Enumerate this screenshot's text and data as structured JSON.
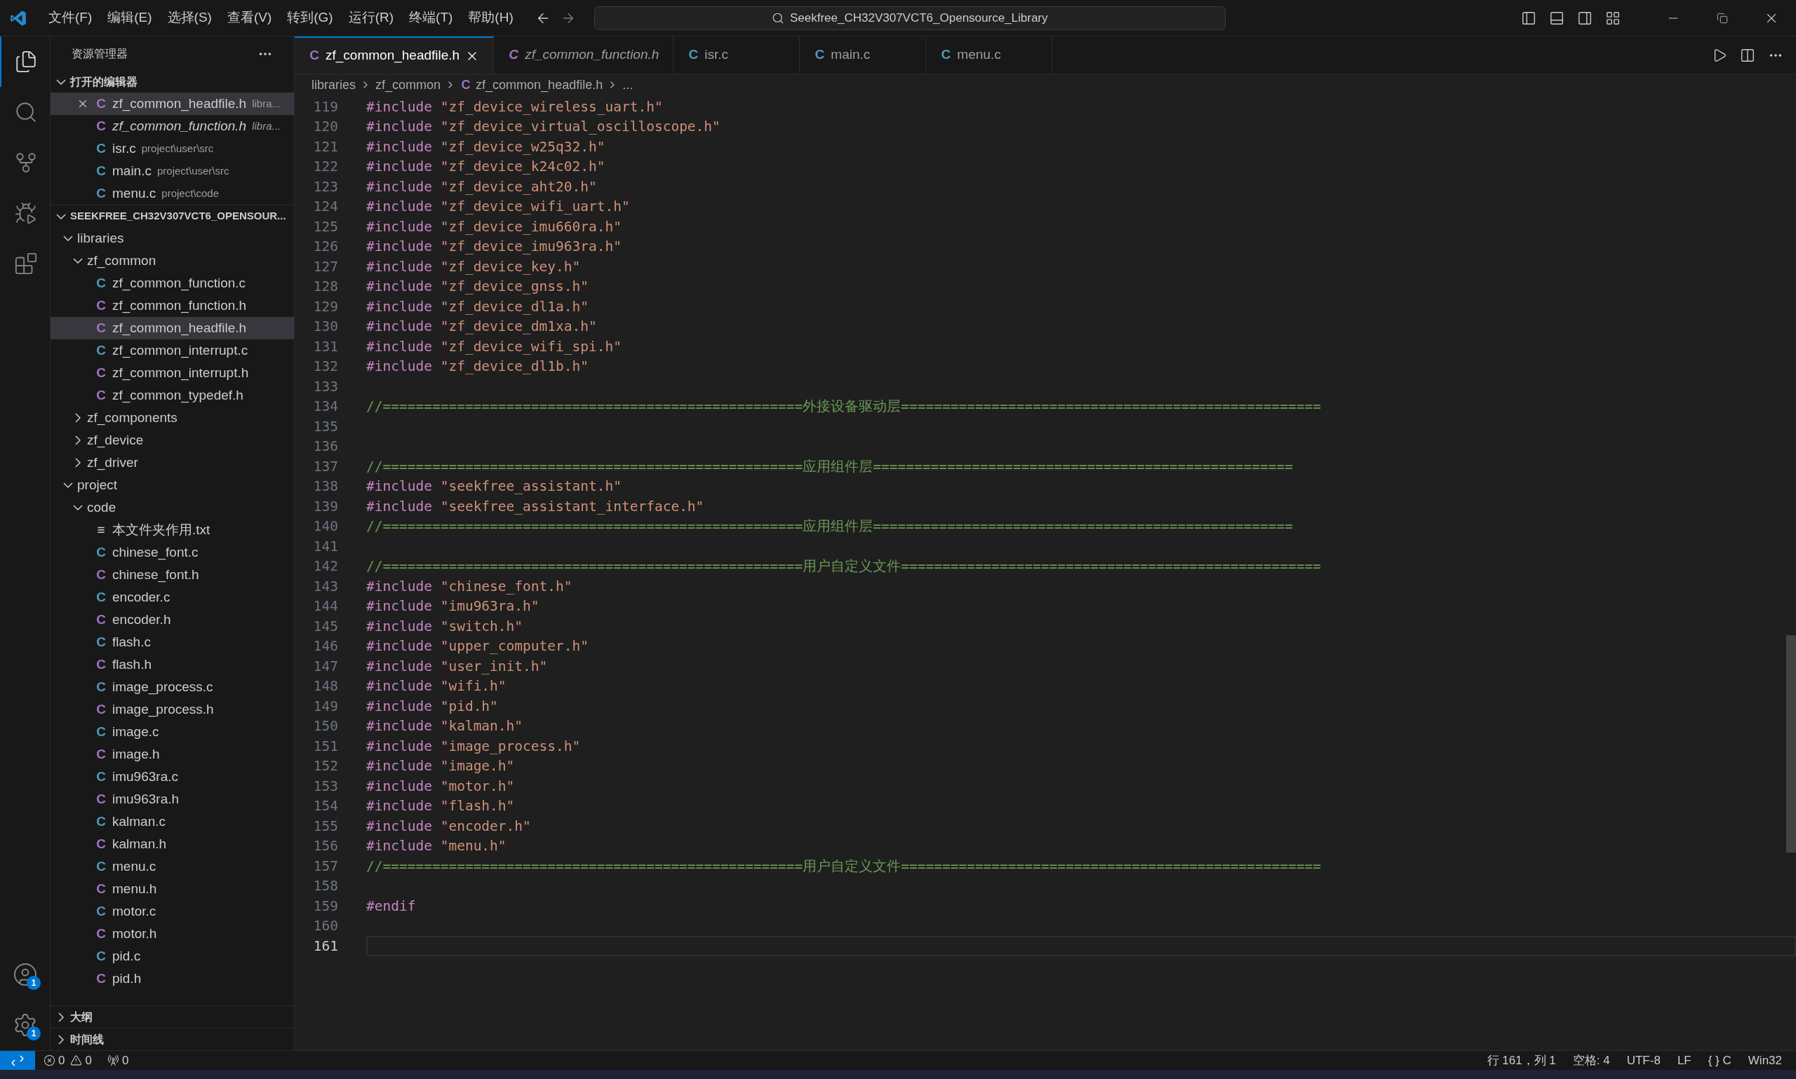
{
  "menu": [
    "文件(F)",
    "编辑(E)",
    "选择(S)",
    "查看(V)",
    "转到(G)",
    "运行(R)",
    "终端(T)",
    "帮助(H)"
  ],
  "search": {
    "value": "Seekfree_CH32V307VCT6_Opensource_Library"
  },
  "activity_bar": {
    "items": [
      {
        "kind": "explorer",
        "selected": true
      },
      {
        "kind": "search",
        "selected": false
      },
      {
        "kind": "source_control",
        "selected": false
      },
      {
        "kind": "debug",
        "selected": false
      },
      {
        "kind": "extensions",
        "selected": false
      }
    ],
    "bottom": [
      {
        "kind": "accounts",
        "badge": "1"
      },
      {
        "kind": "settings",
        "badge": "1"
      }
    ]
  },
  "sidebar": {
    "title": "资源管理器",
    "open_editors": {
      "label": "打开的编辑器",
      "expanded": true,
      "items": [
        {
          "icon": "C",
          "color": "#a074c4",
          "name": "zf_common_headfile.h",
          "path": "libra...",
          "preview": false,
          "selected": true
        },
        {
          "icon": "C",
          "color": "#a074c4",
          "name": "zf_common_function.h",
          "path": "libra...",
          "preview": true,
          "selected": false
        },
        {
          "icon": "C",
          "color": "#519aba",
          "name": "isr.c",
          "path": "project\\user\\src",
          "preview": false,
          "selected": false
        },
        {
          "icon": "C",
          "color": "#519aba",
          "name": "main.c",
          "path": "project\\user\\src",
          "preview": false,
          "selected": false
        },
        {
          "icon": "C",
          "color": "#519aba",
          "name": "menu.c",
          "path": "project\\code",
          "preview": false,
          "selected": false
        }
      ]
    },
    "workspace": {
      "label": "SEEKFREE_CH32V307VCT6_OPENSOUR...",
      "expanded": true,
      "children": [
        {
          "kind": "folder",
          "name": "libraries",
          "expanded": true,
          "selected": false,
          "children": [
            {
              "kind": "folder",
              "name": "zf_common",
              "expanded": true,
              "selected": false,
              "children": [
                {
                  "kind": "file",
                  "icon": "C",
                  "color": "#519aba",
                  "name": "zf_common_function.c",
                  "selected": false
                },
                {
                  "kind": "file",
                  "icon": "C",
                  "color": "#a074c4",
                  "name": "zf_common_function.h",
                  "selected": false
                },
                {
                  "kind": "file",
                  "icon": "C",
                  "color": "#a074c4",
                  "name": "zf_common_headfile.h",
                  "selected": true
                },
                {
                  "kind": "file",
                  "icon": "C",
                  "color": "#519aba",
                  "name": "zf_common_interrupt.c",
                  "selected": false
                },
                {
                  "kind": "file",
                  "icon": "C",
                  "color": "#a074c4",
                  "name": "zf_common_interrupt.h",
                  "selected": false
                },
                {
                  "kind": "file",
                  "icon": "C",
                  "color": "#a074c4",
                  "name": "zf_common_typedef.h",
                  "selected": false
                }
              ]
            },
            {
              "kind": "folder",
              "name": "zf_components",
              "expanded": false,
              "selected": false
            },
            {
              "kind": "folder",
              "name": "zf_device",
              "expanded": false,
              "selected": false
            },
            {
              "kind": "folder",
              "name": "zf_driver",
              "expanded": false,
              "selected": false
            }
          ]
        },
        {
          "kind": "folder",
          "name": "project",
          "expanded": true,
          "selected": false,
          "children": [
            {
              "kind": "folder",
              "name": "code",
              "expanded": true,
              "selected": false,
              "children": [
                {
                  "kind": "file",
                  "icon": "≡",
                  "color": "#cccccc",
                  "name": "本文件夹作用.txt",
                  "selected": false
                },
                {
                  "kind": "file",
                  "icon": "C",
                  "color": "#519aba",
                  "name": "chinese_font.c",
                  "selected": false
                },
                {
                  "kind": "file",
                  "icon": "C",
                  "color": "#a074c4",
                  "name": "chinese_font.h",
                  "selected": false
                },
                {
                  "kind": "file",
                  "icon": "C",
                  "color": "#519aba",
                  "name": "encoder.c",
                  "selected": false
                },
                {
                  "kind": "file",
                  "icon": "C",
                  "color": "#a074c4",
                  "name": "encoder.h",
                  "selected": false
                },
                {
                  "kind": "file",
                  "icon": "C",
                  "color": "#519aba",
                  "name": "flash.c",
                  "selected": false
                },
                {
                  "kind": "file",
                  "icon": "C",
                  "color": "#a074c4",
                  "name": "flash.h",
                  "selected": false
                },
                {
                  "kind": "file",
                  "icon": "C",
                  "color": "#519aba",
                  "name": "image_process.c",
                  "selected": false
                },
                {
                  "kind": "file",
                  "icon": "C",
                  "color": "#a074c4",
                  "name": "image_process.h",
                  "selected": false
                },
                {
                  "kind": "file",
                  "icon": "C",
                  "color": "#519aba",
                  "name": "image.c",
                  "selected": false
                },
                {
                  "kind": "file",
                  "icon": "C",
                  "color": "#a074c4",
                  "name": "image.h",
                  "selected": false
                },
                {
                  "kind": "file",
                  "icon": "C",
                  "color": "#519aba",
                  "name": "imu963ra.c",
                  "selected": false
                },
                {
                  "kind": "file",
                  "icon": "C",
                  "color": "#a074c4",
                  "name": "imu963ra.h",
                  "selected": false
                },
                {
                  "kind": "file",
                  "icon": "C",
                  "color": "#519aba",
                  "name": "kalman.c",
                  "selected": false
                },
                {
                  "kind": "file",
                  "icon": "C",
                  "color": "#a074c4",
                  "name": "kalman.h",
                  "selected": false
                },
                {
                  "kind": "file",
                  "icon": "C",
                  "color": "#519aba",
                  "name": "menu.c",
                  "selected": false
                },
                {
                  "kind": "file",
                  "icon": "C",
                  "color": "#a074c4",
                  "name": "menu.h",
                  "selected": false
                },
                {
                  "kind": "file",
                  "icon": "C",
                  "color": "#519aba",
                  "name": "motor.c",
                  "selected": false
                },
                {
                  "kind": "file",
                  "icon": "C",
                  "color": "#a074c4",
                  "name": "motor.h",
                  "selected": false
                },
                {
                  "kind": "file",
                  "icon": "C",
                  "color": "#519aba",
                  "name": "pid.c",
                  "selected": false
                },
                {
                  "kind": "file",
                  "icon": "C",
                  "color": "#a074c4",
                  "name": "pid.h",
                  "selected": false
                }
              ]
            }
          ]
        }
      ]
    },
    "panels": [
      {
        "label": "大纲",
        "expanded": false
      },
      {
        "label": "时间线",
        "expanded": false
      }
    ]
  },
  "tabs": [
    {
      "icon": "C",
      "color": "#a074c4",
      "label": "zf_common_headfile.h",
      "selected": true,
      "preview": false
    },
    {
      "icon": "C",
      "color": "#a074c4",
      "label": "zf_common_function.h",
      "selected": false,
      "preview": true
    },
    {
      "icon": "C",
      "color": "#519aba",
      "label": "isr.c",
      "selected": false,
      "preview": false
    },
    {
      "icon": "C",
      "color": "#519aba",
      "label": "main.c",
      "selected": false,
      "preview": false
    },
    {
      "icon": "C",
      "color": "#519aba",
      "label": "menu.c",
      "selected": false,
      "preview": false
    }
  ],
  "breadcrumb": [
    {
      "label": "libraries"
    },
    {
      "label": "zf_common"
    },
    {
      "label": "zf_common_headfile.h",
      "icon": "C",
      "color": "#a074c4"
    },
    {
      "label": "..."
    }
  ],
  "code": [
    {
      "n": "119",
      "kind": "include",
      "keyword": "#include",
      "path": "\"zf_device_wireless_uart.h\"",
      "current": false
    },
    {
      "n": "120",
      "kind": "include",
      "keyword": "#include",
      "path": "\"zf_device_virtual_oscilloscope.h\"",
      "current": false
    },
    {
      "n": "121",
      "kind": "include",
      "keyword": "#include",
      "path": "\"zf_device_w25q32.h\"",
      "current": false
    },
    {
      "n": "122",
      "kind": "include",
      "keyword": "#include",
      "path": "\"zf_device_k24c02.h\"",
      "current": false
    },
    {
      "n": "123",
      "kind": "include",
      "keyword": "#include",
      "path": "\"zf_device_aht20.h\"",
      "current": false
    },
    {
      "n": "124",
      "kind": "include",
      "keyword": "#include",
      "path": "\"zf_device_wifi_uart.h\"",
      "current": false
    },
    {
      "n": "125",
      "kind": "include",
      "keyword": "#include",
      "path": "\"zf_device_imu660ra.h\"",
      "current": false
    },
    {
      "n": "126",
      "kind": "include",
      "keyword": "#include",
      "path": "\"zf_device_imu963ra.h\"",
      "current": false
    },
    {
      "n": "127",
      "kind": "include",
      "keyword": "#include",
      "path": "\"zf_device_key.h\"",
      "current": false
    },
    {
      "n": "128",
      "kind": "include",
      "keyword": "#include",
      "path": "\"zf_device_gnss.h\"",
      "current": false
    },
    {
      "n": "129",
      "kind": "include",
      "keyword": "#include",
      "path": "\"zf_device_dl1a.h\"",
      "current": false
    },
    {
      "n": "130",
      "kind": "include",
      "keyword": "#include",
      "path": "\"zf_device_dm1xa.h\"",
      "current": false
    },
    {
      "n": "131",
      "kind": "include",
      "keyword": "#include",
      "path": "\"zf_device_wifi_spi.h\"",
      "current": false
    },
    {
      "n": "132",
      "kind": "include",
      "keyword": "#include",
      "path": "\"zf_device_dl1b.h\"",
      "current": false
    },
    {
      "n": "133",
      "kind": "blank",
      "current": false
    },
    {
      "n": "134",
      "kind": "comment",
      "text": "//===================================================外接设备驱动层===================================================",
      "current": false
    },
    {
      "n": "135",
      "kind": "blank",
      "current": false
    },
    {
      "n": "136",
      "kind": "blank",
      "current": false
    },
    {
      "n": "137",
      "kind": "comment",
      "text": "//===================================================应用组件层===================================================",
      "current": false
    },
    {
      "n": "138",
      "kind": "include",
      "keyword": "#include",
      "path": "\"seekfree_assistant.h\"",
      "current": false
    },
    {
      "n": "139",
      "kind": "include",
      "keyword": "#include",
      "path": "\"seekfree_assistant_interface.h\"",
      "current": false
    },
    {
      "n": "140",
      "kind": "comment",
      "text": "//===================================================应用组件层===================================================",
      "current": false
    },
    {
      "n": "141",
      "kind": "blank",
      "current": false
    },
    {
      "n": "142",
      "kind": "comment",
      "text": "//===================================================用户自定义文件===================================================",
      "current": false
    },
    {
      "n": "143",
      "kind": "include",
      "keyword": "#include",
      "path": "\"chinese_font.h\"",
      "current": false
    },
    {
      "n": "144",
      "kind": "include",
      "keyword": "#include",
      "path": "\"imu963ra.h\"",
      "current": false
    },
    {
      "n": "145",
      "kind": "include",
      "keyword": "#include",
      "path": "\"switch.h\"",
      "current": false
    },
    {
      "n": "146",
      "kind": "include",
      "keyword": "#include",
      "path": "\"upper_computer.h\"",
      "current": false
    },
    {
      "n": "147",
      "kind": "include",
      "keyword": "#include",
      "path": "\"user_init.h\"",
      "current": false
    },
    {
      "n": "148",
      "kind": "include",
      "keyword": "#include",
      "path": "\"wifi.h\"",
      "current": false
    },
    {
      "n": "149",
      "kind": "include",
      "keyword": "#include",
      "path": "\"pid.h\"",
      "current": false
    },
    {
      "n": "150",
      "kind": "include",
      "keyword": "#include",
      "path": "\"kalman.h\"",
      "current": false
    },
    {
      "n": "151",
      "kind": "include",
      "keyword": "#include",
      "path": "\"image_process.h\"",
      "current": false
    },
    {
      "n": "152",
      "kind": "include",
      "keyword": "#include",
      "path": "\"image.h\"",
      "current": false
    },
    {
      "n": "153",
      "kind": "include",
      "keyword": "#include",
      "path": "\"motor.h\"",
      "current": false
    },
    {
      "n": "154",
      "kind": "include",
      "keyword": "#include",
      "path": "\"flash.h\"",
      "current": false
    },
    {
      "n": "155",
      "kind": "include",
      "keyword": "#include",
      "path": "\"encoder.h\"",
      "current": false
    },
    {
      "n": "156",
      "kind": "include",
      "keyword": "#include",
      "path": "\"menu.h\"",
      "current": false
    },
    {
      "n": "157",
      "kind": "comment",
      "text": "//===================================================用户自定义文件===================================================",
      "current": false
    },
    {
      "n": "158",
      "kind": "blank",
      "current": false
    },
    {
      "n": "159",
      "kind": "directive",
      "text": "#endif",
      "current": false
    },
    {
      "n": "160",
      "kind": "blank",
      "current": false
    },
    {
      "n": "161",
      "kind": "blank",
      "current": true
    }
  ],
  "status_bar": {
    "errors": "0",
    "warnings": "0",
    "ports": "0",
    "right": [
      "行 161，列 1",
      "空格: 4",
      "UTF-8",
      "LF",
      "{ } C",
      "Win32"
    ]
  }
}
